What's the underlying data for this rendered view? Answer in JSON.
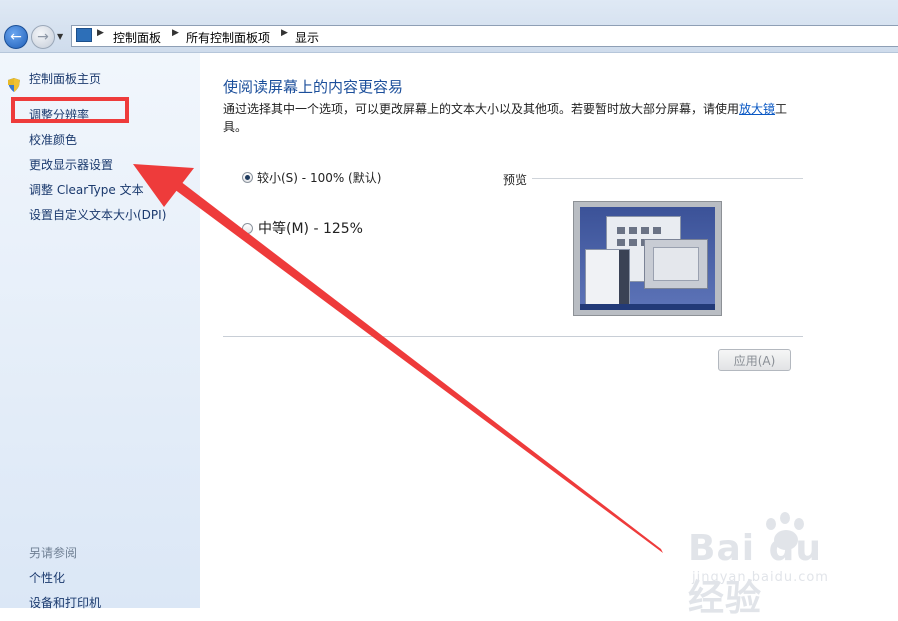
{
  "addressbar": {
    "crumbs": [
      "控制面板",
      "所有控制面板项",
      "显示"
    ]
  },
  "sidebar": {
    "items": [
      {
        "label": "控制面板主页"
      },
      {
        "label": "调整分辨率"
      },
      {
        "label": "校准颜色"
      },
      {
        "label": "更改显示器设置"
      },
      {
        "label": "调整 ClearType 文本"
      },
      {
        "label": "设置自定义文本大小(DPI)"
      }
    ],
    "see_also_title": "另请参阅",
    "see_also_items": [
      {
        "label": "个性化"
      },
      {
        "label": "设备和打印机"
      }
    ]
  },
  "main": {
    "title": "使阅读屏幕上的内容更容易",
    "description_before": "通过选择其中一个选项，可以更改屏幕上的文本大小以及其他项。若要暂时放大部分屏幕，请使用",
    "magnifier_link": "放大镜",
    "description_after": "工具。",
    "options": [
      {
        "label": "较小(S) - 100% (默认)",
        "selected": true
      },
      {
        "label": "中等(M) - 125%",
        "selected": false
      }
    ],
    "preview_label": "预览",
    "apply_button": "应用(A)",
    "apply_enabled": false
  },
  "watermark": {
    "brand": "Bai du 经验",
    "url": "jingyan.baidu.com"
  },
  "colors": {
    "annotation_red": "#ee3b3b",
    "link_blue": "#0a58c4",
    "title_blue": "#1c4f9b"
  }
}
